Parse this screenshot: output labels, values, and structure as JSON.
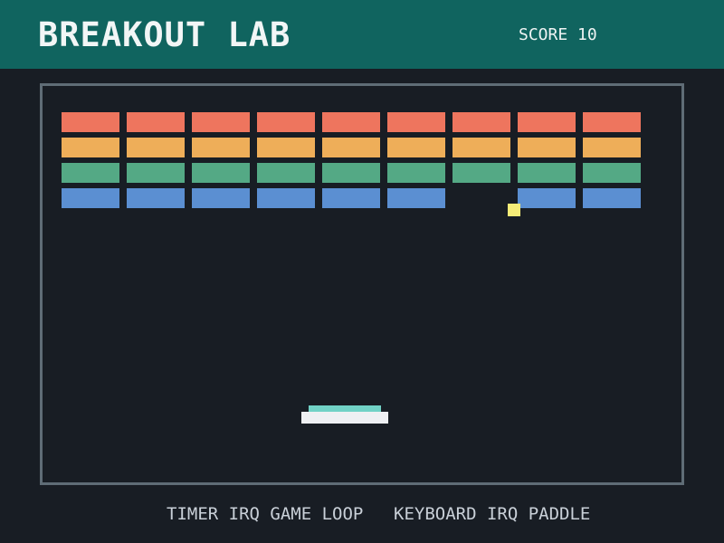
{
  "header": {
    "title": "BREAKOUT LAB",
    "score": "SCORE 10"
  },
  "bricks": {
    "row_colors": [
      "#ee755e",
      "#eeae59",
      "#54a985",
      "#5b8fd2"
    ],
    "columns": 9,
    "missing": [
      [
        3,
        6
      ]
    ]
  },
  "ball": {
    "color": "#f6ed78"
  },
  "paddle": {
    "color_top": "#71d2c6",
    "color_base": "#eef0f3"
  },
  "footer": {
    "timer_label": "TIMER IRQ GAME LOOP",
    "keyboard_label": "KEYBOARD IRQ PADDLE"
  }
}
